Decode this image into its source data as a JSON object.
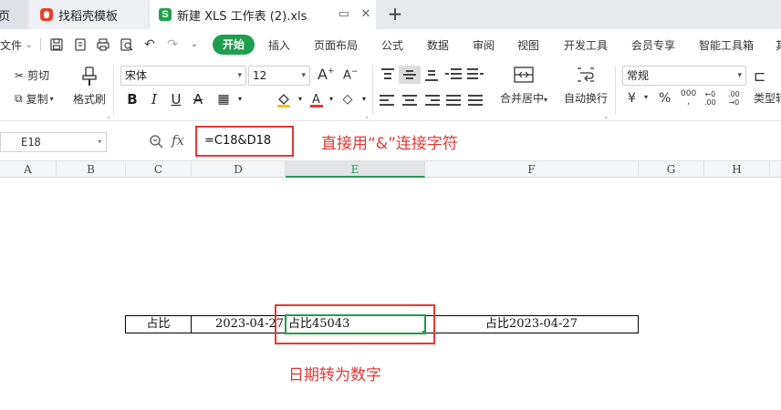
{
  "tabs": {
    "home_label": "页",
    "dochub_label": "找稻壳模板",
    "active_label": "新建 XLS 工作表 (2).xls",
    "sheet_icon_letter": "S",
    "new_tab": "+"
  },
  "menu": {
    "file": "文件",
    "start": "开始",
    "items": [
      "插入",
      "页面布局",
      "公式",
      "数据",
      "审阅",
      "视图",
      "开发工具",
      "会员专享",
      "智能工具箱",
      "其"
    ]
  },
  "ribbon": {
    "cut": "剪切",
    "copy": "复制",
    "format_painter": "格式刷",
    "font_name": "宋体",
    "font_size": "12",
    "merge_center": "合并居中",
    "wrap_text": "自动换行",
    "number_format": "常规",
    "type_convert": "类型转"
  },
  "formula_bar": {
    "cell_ref": "E18",
    "fx": "fx",
    "formula": "=C18&D18"
  },
  "columns": [
    "A",
    "B",
    "C",
    "D",
    "E",
    "F",
    "G",
    "H"
  ],
  "selected_column": "E",
  "row": {
    "c": "占比",
    "d": "2023-04-27",
    "e": "占比45043",
    "f": "占比2023-04-27"
  },
  "annotations": {
    "formula_note": "直接用“&”连接字符",
    "result_note": "日期转为数字",
    "annotation_color": "#e53935"
  },
  "colors": {
    "accent_green": "#1e9e4f"
  }
}
